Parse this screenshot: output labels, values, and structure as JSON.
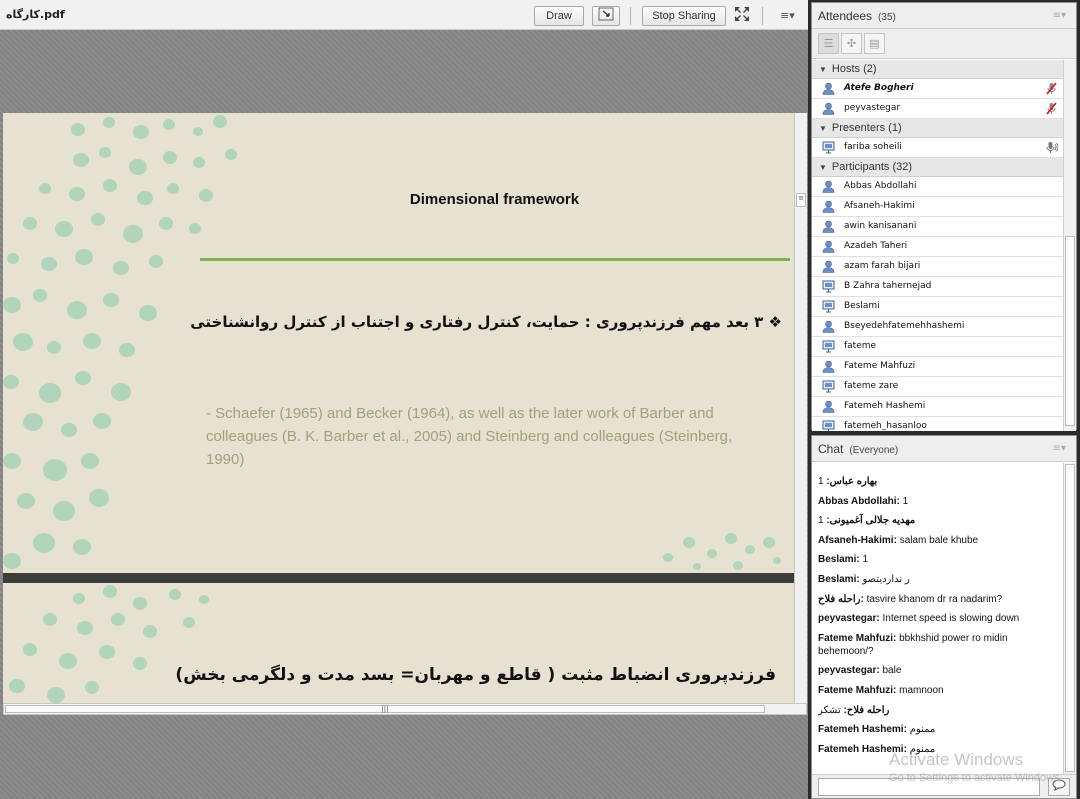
{
  "share": {
    "title": "کارگاه.pdf",
    "draw_label": "Draw",
    "stop_label": "Stop Sharing",
    "menu_glyph": "≡▾"
  },
  "slide1": {
    "title": "Dimensional framework",
    "bullet": "❖ ۳ بعد مهم فرزندپروری : حمایت، کنترل رفتاری و اجتناب از کنترل روانشناختی",
    "body": "-  Schaefer (1965) and Becker (1964), as well as the later work of Barber and colleagues (B. K. Barber et al., 2005) and Steinberg and colleagues (Steinberg, 1990)"
  },
  "slide2": {
    "text": "فرزندپروری انضباط مثبت ( قاطع و مهربان= بسد مدت و دلگرمی بخش)"
  },
  "colors": {
    "accent_green": "#7bb34e",
    "slide_bg": "#e6e1d0",
    "dot_green": "#a7d2b7"
  },
  "attendees": {
    "title": "Attendees",
    "count": "(35)",
    "groups": [
      {
        "label": "Hosts (2)",
        "rows": [
          {
            "name": "Atefe Bogheri",
            "italic": true,
            "status": "mic-off-icon"
          },
          {
            "name": "peyvastegar",
            "italic": false,
            "status": "mic-off-icon"
          }
        ]
      },
      {
        "label": "Presenters (1)",
        "rows": [
          {
            "name": "fariba soheili",
            "italic": false,
            "status": "mic-on-icon"
          }
        ]
      },
      {
        "label": "Participants (32)",
        "rows": [
          {
            "name": "Abbas Abdollahi"
          },
          {
            "name": "Afsaneh-Hakimi"
          },
          {
            "name": "awin kanisanani"
          },
          {
            "name": "Azadeh Taheri"
          },
          {
            "name": "azam farah bijari"
          },
          {
            "name": "B Zahra tahernejad"
          },
          {
            "name": "Beslami"
          },
          {
            "name": "Bseyedehfatemehhashemi"
          },
          {
            "name": "fateme"
          },
          {
            "name": "Fateme Mahfuzi"
          },
          {
            "name": "fateme zare"
          },
          {
            "name": "Fatemeh Hashemi"
          },
          {
            "name": "fatemeh_hasanloo"
          }
        ]
      }
    ]
  },
  "chat": {
    "title": "Chat",
    "scope": "(Everyone)",
    "messages": [
      {
        "sender": "بهاره عباس",
        "text": "1",
        "rtl": true
      },
      {
        "sender": "Abbas Abdollahi",
        "text": "1"
      },
      {
        "sender": "مهدیه جلالی آغمیونی",
        "text": "1",
        "rtl": true
      },
      {
        "sender": "Afsaneh-Hakimi",
        "text": "salam bale khube"
      },
      {
        "sender": "Beslami",
        "text": "1"
      },
      {
        "sender": "Beslami",
        "text": "ر نداردیتصو"
      },
      {
        "sender": "راحله فلاح",
        "text": "tasvire khanom dr ra nadarim?",
        "rtl": true
      },
      {
        "sender": "peyvastegar",
        "text": "Internet speed is slowing down"
      },
      {
        "sender": "Fateme Mahfuzi",
        "text": "bbkhshid power ro midin behemoon/?"
      },
      {
        "sender": "peyvastegar",
        "text": "bale"
      },
      {
        "sender": "Fateme Mahfuzi",
        "text": "mamnoon"
      },
      {
        "sender": "راحله فلاح",
        "text": "تشکر",
        "rtl": true
      },
      {
        "sender": "Fatemeh Hashemi",
        "text": "ممنوم"
      },
      {
        "sender": "Fatemeh Hashemi",
        "text": "ممنوم"
      }
    ],
    "send_icon": "speech-bubble-icon"
  },
  "watermark": {
    "line1": "Activate Windows",
    "line2": "Go to Settings to activate Windows."
  }
}
